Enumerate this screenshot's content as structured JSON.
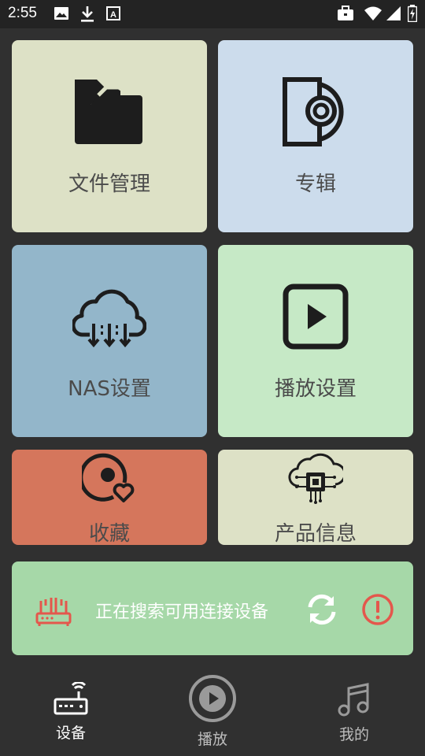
{
  "status_bar": {
    "time": "2:55",
    "left_icons": [
      "image-icon",
      "download-icon",
      "font-a-icon"
    ],
    "right_icons": [
      "briefcase-icon",
      "wifi-icon",
      "signal-icon",
      "battery-charging-icon"
    ]
  },
  "tiles": [
    {
      "label": "文件管理",
      "icon": "folder-icon",
      "color": "#dde1c6"
    },
    {
      "label": "专辑",
      "icon": "album-disc-icon",
      "color": "#ccdcec"
    },
    {
      "label": "NAS设置",
      "icon": "cloud-download-icon",
      "color": "#93b6ca"
    },
    {
      "label": "播放设置",
      "icon": "play-square-icon",
      "color": "#c6e9c6"
    },
    {
      "label": "收藏",
      "icon": "favorite-disc-icon",
      "color": "#d5765c"
    },
    {
      "label": "产品信息",
      "icon": "cloud-chip-icon",
      "color": "#dde1c6"
    }
  ],
  "connection": {
    "status_text": "正在搜索可用连接设备",
    "background": "#a6d8a8",
    "router_icon_color": "#e4574c",
    "alert_icon_color": "#e4574c"
  },
  "bottom_nav": {
    "items": [
      {
        "label": "设备",
        "icon": "router-icon",
        "active": true
      },
      {
        "label": "播放",
        "icon": "play-circle-icon",
        "active": false
      },
      {
        "label": "我的",
        "icon": "music-note-icon",
        "active": false
      }
    ],
    "active_color": "#ffffff",
    "inactive_color": "#9a9a9a"
  }
}
